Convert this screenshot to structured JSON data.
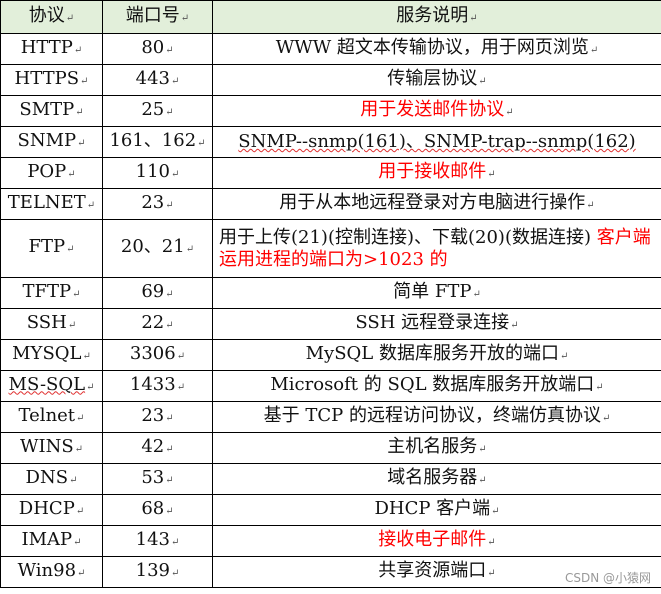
{
  "header": {
    "protocol": "协议",
    "port": "端口号",
    "description": "服务说明"
  },
  "rows": [
    {
      "protocol": "HTTP",
      "port": "80",
      "description": "WWW 超文本传输协议，用于网页浏览",
      "color": "#111111"
    },
    {
      "protocol": "HTTPS",
      "port": "443",
      "description": "传输层协议",
      "color": "#111111"
    },
    {
      "protocol": "SMTP",
      "port": "25",
      "description": "用于发送邮件协议",
      "color": "#ff0000"
    },
    {
      "protocol": "SNMP",
      "port": "161、162",
      "description": "SNMP--snmp(161)、SNMP-trap--snmp(162)",
      "color": "#111111"
    },
    {
      "protocol": "POP",
      "port": "110",
      "description": "用于接收邮件",
      "color": "#ff0000"
    },
    {
      "protocol": "TELNET",
      "port": "23",
      "description": "用于从本地远程登录对方电脑进行操作",
      "color": "#111111"
    },
    {
      "protocol": "FTP",
      "port": "20、21",
      "description_part1": "用于上传(21)(控制连接)、下载(20)(数据连接)",
      "description_part2": "客户端运用进程的端口为>1023 的",
      "color": "#111111",
      "part2_color": "#ff0000"
    },
    {
      "protocol": "TFTP",
      "port": "69",
      "description": "简单 FTP",
      "color": "#111111"
    },
    {
      "protocol": "SSH",
      "port": "22",
      "description": "SSH 远程登录连接",
      "color": "#111111"
    },
    {
      "protocol": "MYSQL",
      "port": "3306",
      "description": "MySQL 数据库服务开放的端口",
      "color": "#111111"
    },
    {
      "protocol": "MS-SQL",
      "port": "1433",
      "description": "Microsoft 的 SQL 数据库服务开放端口",
      "color": "#111111"
    },
    {
      "protocol": "Telnet",
      "port": "23",
      "description": "基于 TCP 的远程访问协议，终端仿真协议",
      "color": "#111111"
    },
    {
      "protocol": "WINS",
      "port": "42",
      "description": "主机名服务",
      "color": "#111111"
    },
    {
      "protocol": "DNS",
      "port": "53",
      "description": "域名服务器",
      "color": "#111111"
    },
    {
      "protocol": "DHCP",
      "port": "68",
      "description": "DHCP 客户端",
      "color": "#111111"
    },
    {
      "protocol": "IMAP",
      "port": "143",
      "description": "接收电子邮件",
      "color": "#ff0000"
    },
    {
      "protocol": "Win98",
      "port": "139",
      "description": "共享资源端口",
      "color": "#111111"
    }
  ],
  "watermark": "CSDN @小猿网"
}
